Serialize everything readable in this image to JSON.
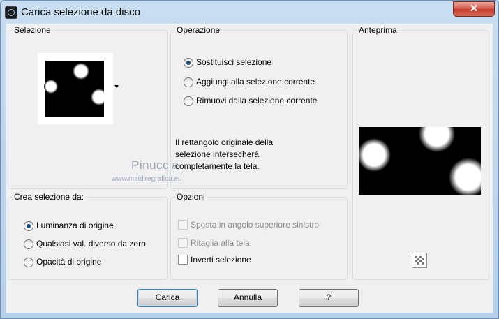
{
  "window": {
    "title": "Carica selezione da disco",
    "close_glyph": "✕"
  },
  "selection": {
    "label": "Selezione"
  },
  "operation": {
    "label": "Operazione",
    "options": [
      {
        "label": "Sostituisci selezione",
        "selected": true
      },
      {
        "label": "Aggiungi alla selezione corrente",
        "selected": false
      },
      {
        "label": "Rimuovi dalla selezione corrente",
        "selected": false
      }
    ],
    "info_lines": [
      "Il rettangolo originale della",
      "selezione intersecherà",
      "completamente la tela."
    ]
  },
  "watermark": {
    "name": "Pinuccia",
    "url": "www.maidiregrafica.eu"
  },
  "preview": {
    "label": "Anteprima"
  },
  "create_from": {
    "label": "Crea selezione da:",
    "options": [
      {
        "label": "Luminanza di origine",
        "selected": true
      },
      {
        "label": "Qualsiasi val. diverso da zero",
        "selected": false
      },
      {
        "label": "Opacità di origine",
        "selected": false
      }
    ]
  },
  "options": {
    "label": "Opzioni",
    "items": [
      {
        "label": "Sposta in angolo superiore sinistro",
        "checked": false,
        "disabled": true
      },
      {
        "label": "Ritaglia alla tela",
        "checked": false,
        "disabled": true
      },
      {
        "label": "Inverti selezione",
        "checked": false,
        "disabled": false
      }
    ]
  },
  "buttons": {
    "load": "Carica",
    "cancel": "Annulla",
    "help": "?"
  },
  "colors": {
    "title_bg": "#bcd6ee",
    "close_red": "#c23b2b",
    "client_bg": "#f0f0f0",
    "radio_dot": "#1b4f7a"
  }
}
